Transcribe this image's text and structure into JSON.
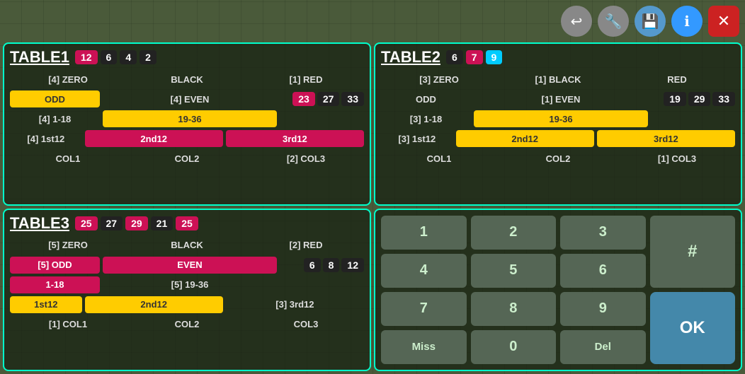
{
  "toolbar": {
    "back_label": "↩",
    "wrench_label": "🔧",
    "save_label": "💾",
    "info_label": "ℹ",
    "close_label": "✕"
  },
  "table1": {
    "title": "TABLE1",
    "badges": [
      "12",
      "6",
      "4",
      "2"
    ],
    "badge_colors": [
      "pink",
      "black",
      "black",
      "black"
    ],
    "rows": [
      {
        "cols": [
          "[4] ZERO",
          "BLACK",
          "[1] RED"
        ]
      },
      {
        "cols": [
          "ODD",
          "[4] EVEN",
          ""
        ]
      },
      {
        "extra_badges": [
          "23",
          "27",
          "33"
        ]
      },
      {
        "cols": [
          "[4] 1-18",
          "19-36",
          ""
        ]
      },
      {
        "cols": [
          "[4] 1st12",
          "2nd12",
          "3rd12"
        ]
      },
      {
        "cols": [
          "COL1",
          "COL2",
          "[2] COL3"
        ]
      }
    ]
  },
  "table2": {
    "title": "TABLE2",
    "badges": [
      "6",
      "7",
      "9"
    ],
    "badge_colors": [
      "black",
      "pink",
      "cyan"
    ],
    "rows": [
      {
        "cols": [
          "[3] ZERO",
          "[1] BLACK",
          "RED"
        ]
      },
      {
        "cols": [
          "ODD",
          "[1] EVEN",
          ""
        ]
      },
      {
        "extra_badges": [
          "19",
          "29",
          "33"
        ]
      },
      {
        "cols": [
          "[3] 1-18",
          "19-36",
          ""
        ]
      },
      {
        "cols": [
          "[3] 1st12",
          "2nd12",
          "3rd12"
        ]
      },
      {
        "cols": [
          "COL1",
          "COL2",
          "[1] COL3"
        ]
      }
    ]
  },
  "table3": {
    "title": "TABLE3",
    "badges": [
      "25",
      "27",
      "29",
      "21",
      "25"
    ],
    "badge_colors": [
      "pink",
      "black",
      "pink",
      "black",
      "pink"
    ],
    "rows": [
      {
        "cols": [
          "[5] ZERO",
          "BLACK",
          "[2] RED"
        ]
      },
      {
        "cols": [
          "[5] ODD",
          "EVEN",
          ""
        ]
      },
      {
        "extra_badges": [
          "6",
          "8",
          "12"
        ]
      },
      {
        "cols": [
          "1-18",
          "[5] 19-36",
          ""
        ]
      },
      {
        "cols": [
          "1st12",
          "2nd12",
          "[3] 3rd12"
        ]
      },
      {
        "cols": [
          "[1] COL1",
          "COL2",
          "COL3"
        ]
      }
    ]
  },
  "numpad": {
    "keys": [
      "1",
      "2",
      "3",
      "4",
      "5",
      "6",
      "7",
      "8",
      "9",
      "Miss",
      "0",
      "Del"
    ],
    "hash": "#",
    "ok": "OK"
  }
}
